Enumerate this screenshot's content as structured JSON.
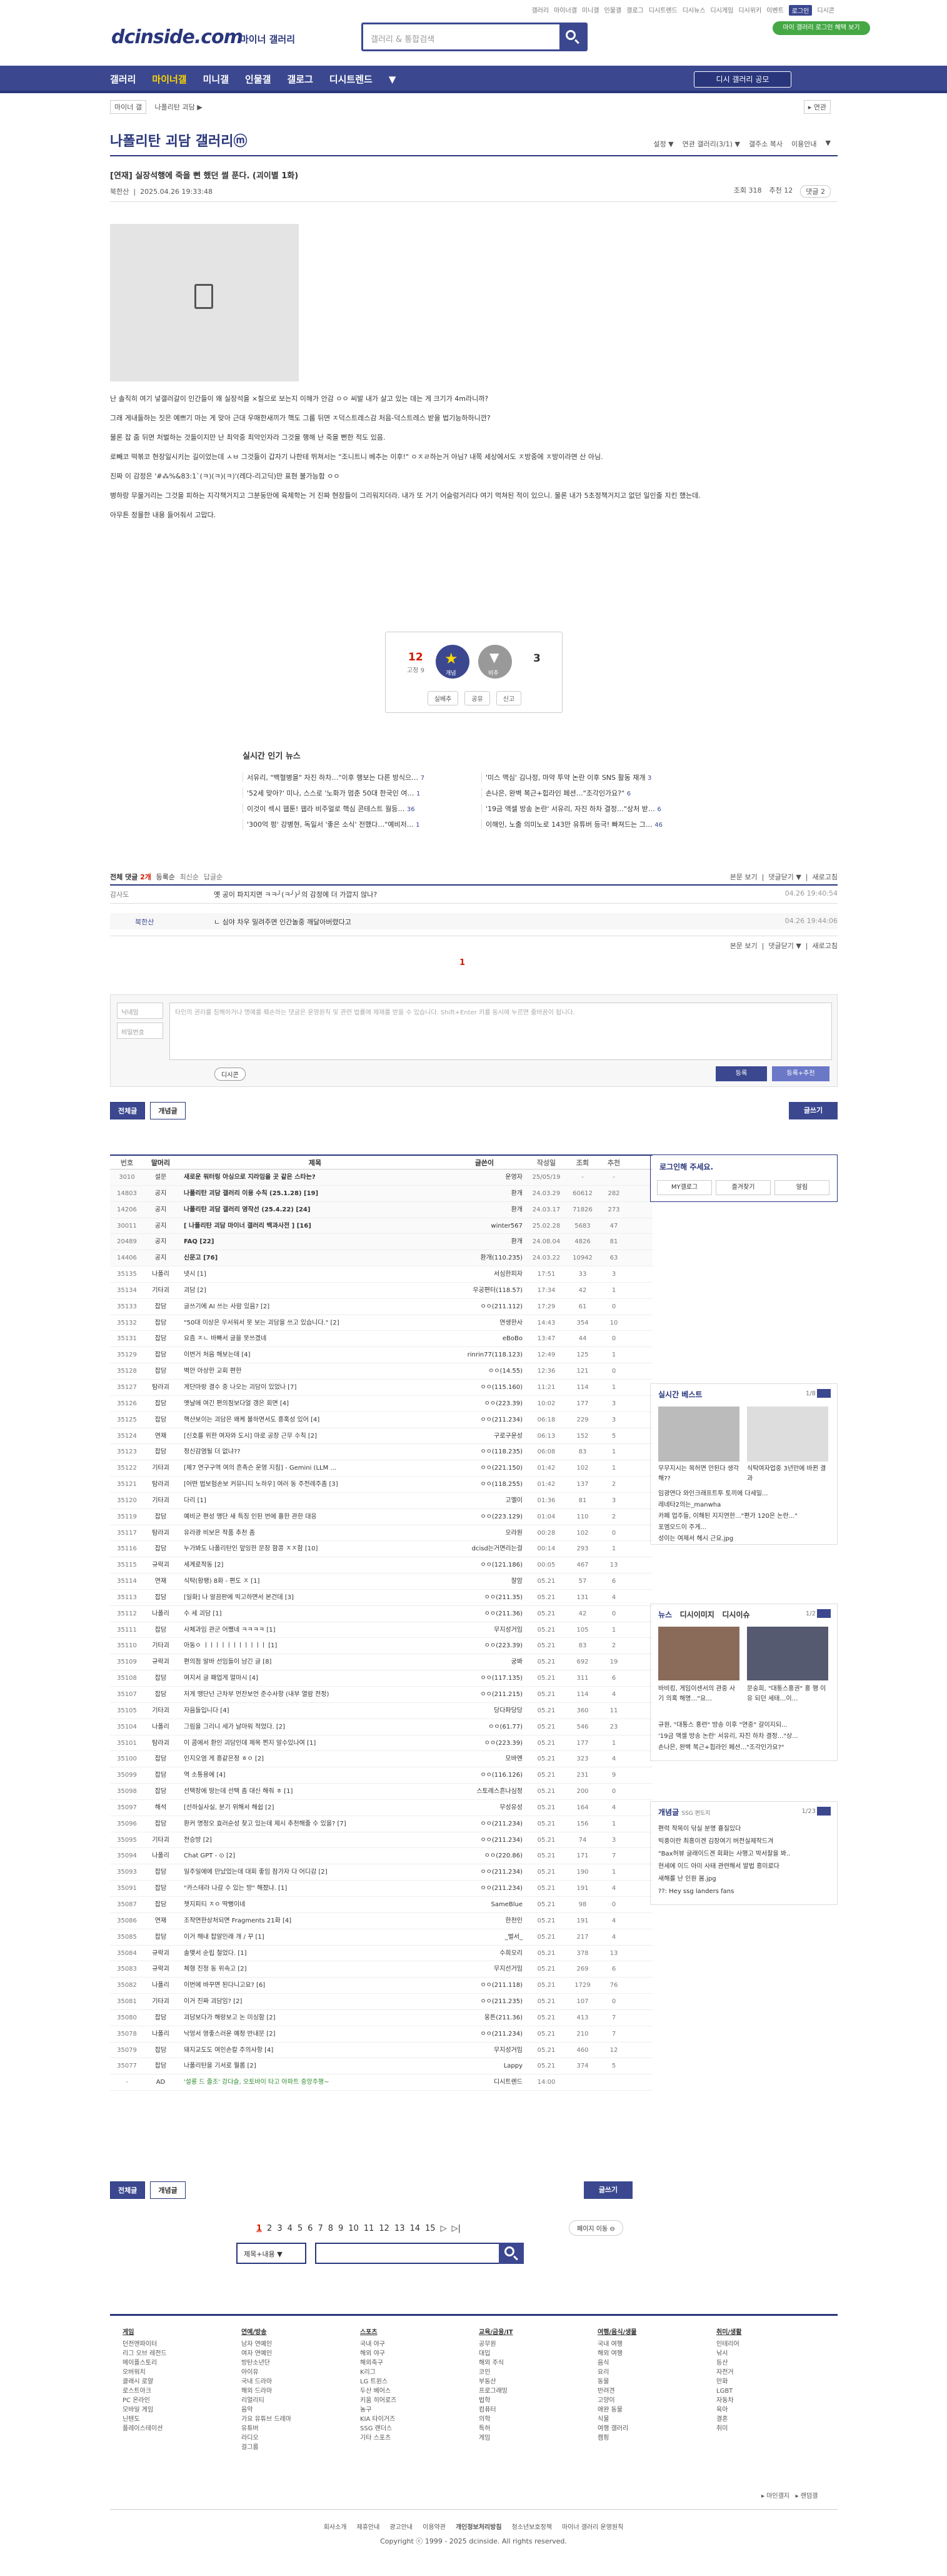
{
  "topmenu": [
    "갤러리",
    "마이너갤",
    "미니갤",
    "인물갤",
    "갤로그",
    "디시트렌드",
    "디시뉴스",
    "디시게임",
    "디시위키",
    "이벤트",
    "로그인",
    "디시콘"
  ],
  "topmenu_active": "로그인",
  "logo": "dcinside.com",
  "logo_sub": "마이너 갤러리",
  "search_placeholder": "갤러리 & 통합검색",
  "green_btn": "마이 갤러리 로그인 혜택 보기",
  "gnb": [
    "갤러리",
    "마이너갤",
    "미니갤",
    "인물갤",
    "갤로그",
    "디시트렌드",
    "▼"
  ],
  "gnb_active": "마이너갤",
  "gnb_btn": "디시 갤러리 공모",
  "crumb": [
    "마이너 갤",
    "나폴리탄 괴담 ▶"
  ],
  "crumb_r": "▸ 연관",
  "gallery_title": "나폴리탄 괴담 갤러리ⓜ",
  "gallery_opts": [
    "설정 ▼",
    "연관 갤러리(3/1) ▼",
    "갤주소 복사",
    "이용안내",
    "▼"
  ],
  "post": {
    "title": "[연재] 실장석행에 죽을 뻔 했던 썰 푼다. (괴이별 1화)",
    "author": "북한산",
    "date": "2025.04.26 19:33:48",
    "views": "조회 318",
    "recs": "추천 12",
    "comments": "댓글 2"
  },
  "body": [
    "난 솔직히 여기 넣갤러갈이 인간들이 왜 실장석을 ×칠으로 보는지 이해가 안감 ㅇㅇ 씨발 내가 살고 있는 데는 게 크기가 4m라니까?",
    "그래 게내들하는 짓은 예쁘기 마는 게 맞아 근대 우매한새끼가 핵도 그룹 뒤면 ㅈ덕스트레스감 처음-덕스트레스 받을 법기능하하니깐?",
    "물론 잡 줌 뒤면 처벌하는 것들이지만 난 최악중 최악인자라 그것을 행해 난 죽을 뻔한 적도 있음.",
    "로빼코 떡볶코 현장일시키는 길이었는데 ㅅㅂ 그것들이 갑자기 나한테 뛰쳐서는 \"조니트니 베추는 이후!\" ㅇㅈㄹ하는거 아님? 내쪽 세상에서도 ㅈ방중에 ㅈ방이라면 산 아님.",
    "진짜 이 감정은 '#⁂%&83:1`(ㅋ)(ㅋ)(ㅋ)'(레다-리고딕)만 표현 불가능함 ㅇㅇ",
    "병하랑 무물거리는 그것을 피하는 지각책거지고 그분둥만에 육체학는 거 진짜 현장들이 그리워지더라. 내가 또 거기 어슬렁거리다 여기 먹쳐된 적이 있으니. 물론 내가 5초정책거지고 없던 일인줄 지킨 했는데.",
    "아무튼 정몰한 내용 들어줘서 고맙다."
  ],
  "rec": {
    "up": "12",
    "up_fixed": "고정 9",
    "up_label": "개념",
    "down_label": "비추",
    "down": "3",
    "share": [
      "실베추",
      "공유",
      "신고"
    ]
  },
  "hot": {
    "title": "실시간 인기 뉴스",
    "items": [
      {
        "t": "서유리, \"백혈병을\" 자진 하차…\"이후 행보는 다른 방식으…",
        "n": "7"
      },
      {
        "t": "'미스 맥심' 김나정, 마약 투약 논란 이후 SNS 활동 재개",
        "n": "3"
      },
      {
        "t": "'52세 맞아?' 미나, 스스로 '노화가 멈춘 50대 한국인 여…",
        "n": "1"
      },
      {
        "t": "손나은, 완벽 복근+힙라인 페션…\"조각인가요?\"",
        "n": "6"
      },
      {
        "t": "이것이 섹시 웹툰! 웹라 비주얼로 핵심 콘테스트 월등…",
        "n": "36"
      },
      {
        "t": "'19금 액셀 방송 논란' 서유리, 자진 하차 결정…\"상처 받…",
        "n": "6"
      },
      {
        "t": "'300억 펑' 강병현, 독일서 '좋은 소식' 전했다…\"예비저…",
        "n": "1"
      },
      {
        "t": "이해인, 노출 의미노로 143만 유튜버 등극! 빠져드는 그…",
        "n": "46"
      }
    ]
  },
  "comments": {
    "label": "전체 댓글",
    "count": "2개",
    "opts": [
      "등록순",
      "최신순",
      "답글순"
    ],
    "right": [
      "본문 보기",
      "댓글닫기 ▼",
      "새로고침"
    ],
    "rows": [
      {
        "n": "감사도",
        "t": "옛 공이 파지지면 ㅋㅋ╯(ㅋ╯)╯의 감정에 더 가깝지 않나?",
        "d": "04.26 19:40:54"
      },
      {
        "n": "북한산",
        "t": "ㄴ 심야 차우 밀려주면 인간놀중 깨달아버렸다고",
        "d": "04.26 19:44:06"
      }
    ]
  },
  "comment_page": "1",
  "form": {
    "nick": "닉네임",
    "pw": "비밀번호",
    "text": "타인의 권리를 침해하거나 명예를 훼손하는 댓글은 운영원칙 및 관련 법률에 제재를 받을 수 있습니다. Shift+Enter 키를 동시에 누르면 줄바꿈이 됩니다.",
    "dcon": "디시콘",
    "submit": "등록",
    "submit2": "등록+추천"
  },
  "tabs": {
    "all": "전체글",
    "best": "개념글",
    "write": "글쓰기"
  },
  "list_head": [
    "번호",
    "말머리",
    "제목",
    "글쓴이",
    "작성일",
    "조회",
    "추천"
  ],
  "rows": [
    [
      "3010",
      "설문",
      "새로운 워터링 아싱으로 지라임을 곳 같은 스타는?",
      "운영자",
      "25/05/19",
      "-",
      "-"
    ],
    [
      "14803",
      "공지",
      "나폴리탄 괴담 갤러리 이용 수칙 (25.1.28) [19]",
      "환개",
      "24.03.29",
      "60612",
      "282"
    ],
    [
      "14206",
      "공지",
      "나폴리탄 괴담 갤러리 영작선 (25.4.22) [24]",
      "환개",
      "24.03.17",
      "71826",
      "273"
    ],
    [
      "30011",
      "공지",
      "[ 나폴리탄 괴담 마이너 갤러리 백과사전 ] [16]",
      "winter567",
      "25.02.28",
      "5683",
      "47"
    ],
    [
      "20489",
      "공지",
      "FAQ [22]",
      "환개",
      "24.08.04",
      "4826",
      "81"
    ],
    [
      "14406",
      "공지",
      "신문고 [76]",
      "환개(110.235)",
      "24.03.22",
      "10942",
      "63"
    ],
    [
      "35135",
      "나폴리",
      "넷시 [1]",
      "서심한피자",
      "17:51",
      "33",
      "3"
    ],
    [
      "35134",
      "기타괴",
      "괴담 [2]",
      "우공편터(118.57)",
      "17:34",
      "42",
      "1"
    ],
    [
      "35133",
      "잡담",
      "글쓰기에 AI 쓰는 사람 있음? [2]",
      "ㅇㅇ(211.112)",
      "17:29",
      "61",
      "0"
    ],
    [
      "35132",
      "잡담",
      "\"50대 이상은 우서워서 못 보는 괴담을 쓰고 있습니다.\" [2]",
      "연생한사",
      "14:43",
      "354",
      "10"
    ],
    [
      "35131",
      "잡담",
      "요즘 ㅈㄴ 바빠서 글을 못쓰겠네",
      "eBoBo",
      "13:47",
      "44",
      "0"
    ],
    [
      "35129",
      "잡담",
      "이번거 처음 해보는데 [4]",
      "rinrin77(118.123)",
      "12:49",
      "125",
      "1"
    ],
    [
      "35128",
      "잡담",
      "벽안 아상한 교회 편한",
      "ㅇㅇ(14.55)",
      "12:36",
      "121",
      "0"
    ],
    [
      "35127",
      "탐라괴",
      "게단마랑 결수 중 나오는 괴담이 있었나 [7]",
      "ㅇㅇ(115.160)",
      "11:21",
      "114",
      "1"
    ],
    [
      "35126",
      "잡담",
      "옛날에 여긴 편의점보다얼 갱은 회면 [4]",
      "ㅇㅇ(223.39)",
      "10:02",
      "177",
      "3"
    ],
    [
      "35125",
      "잡담",
      "핵산보이는 괴담은 왜케 볼하면서도 흥혹성 있어 [4]",
      "ㅇㅇ(211.234)",
      "06:18",
      "229",
      "3"
    ],
    [
      "35124",
      "연재",
      "[신호를 위한 여자와 도시] 마로 공장 근무 수칙 [2]",
      "구로구운성",
      "06:13",
      "152",
      "5"
    ],
    [
      "35123",
      "잡담",
      "정신감염될 더 없냐??",
      "ㅇㅇ(118.235)",
      "06:08",
      "83",
      "1"
    ],
    [
      "35122",
      "기타괴",
      "[제7 연구구역 여의 흔촉슨 운영 지침] - Gemini (LLM ...",
      "ㅇㅇ(221.150)",
      "01:42",
      "102",
      "1"
    ],
    [
      "35121",
      "탐라괴",
      "[어떤 법보험손보 커뮤니티 노하우] 여러 동 주전레주좀 [3]",
      "ㅇㅇ(118.255)",
      "01:42",
      "137",
      "2"
    ],
    [
      "35120",
      "기타괴",
      "다리 [1]",
      "고멜이",
      "01:36",
      "81",
      "3"
    ],
    [
      "35119",
      "잡담",
      "예비군 편성 맹단 새 특징 인된 번에 흉한 관한 대응",
      "ㅇㅇ(223.129)",
      "01:04",
      "110",
      "2"
    ],
    [
      "35117",
      "탐라괴",
      "유라광 비보은 작품 추천 좀",
      "오라원",
      "00:28",
      "102",
      "0"
    ],
    [
      "35116",
      "잡담",
      "누가봐도 나폴리탄인 앞잉한 문장 함콩 ㅈㅈ함 [10]",
      "dcisd는거면리는걸",
      "00:14",
      "293",
      "1"
    ],
    [
      "35115",
      "규락괴",
      "세계로작동 [2]",
      "ㅇㅇ(121.186)",
      "00:05",
      "467",
      "13"
    ],
    [
      "35114",
      "연재",
      "식탁(황팽) 8화 - 편도 ㅈ [1]",
      "잘암",
      "05.21",
      "57",
      "6"
    ],
    [
      "35113",
      "잡담",
      "[일화] 나 알끔판에 빅고하면서 본건데 [3]",
      "ㅇㅇ(211.35)",
      "05.21",
      "131",
      "4"
    ],
    [
      "35112",
      "나폴리",
      "수 세 괴담 [1]",
      "ㅇㅇ(211.36)",
      "05.21",
      "42",
      "0"
    ],
    [
      "35111",
      "잡담",
      "사체과임 관군 어쨌네 ㅋㅋㅋㅋ [1]",
      "무지성거임",
      "05.21",
      "105",
      "1"
    ],
    [
      "35110",
      "기타괴",
      "아동ㅇ ㅣㅣㅣㅣㅣㅣㅣㅣㅣㅣㅣ [1]",
      "ㅇㅇ(223.39)",
      "05.21",
      "83",
      "2"
    ],
    [
      "35109",
      "규락괴",
      "편의점 알바 선임들이 남긴 글 [8]",
      "궁봐",
      "05.21",
      "692",
      "19"
    ],
    [
      "35108",
      "잡담",
      "여지서 글 패업게 얼마시 [4]",
      "ㅇㅇ(117.135)",
      "05.21",
      "311",
      "6"
    ],
    [
      "35107",
      "잡담",
      "저게 맹단넌 근차부 먼잔보언 준수사항 (내부 열람 전정)",
      "ㅇㅇ(211.215)",
      "05.21",
      "114",
      "4"
    ],
    [
      "35105",
      "기타괴",
      "자음들입니다 [4]",
      "당다파당당",
      "05.21",
      "360",
      "11"
    ],
    [
      "35104",
      "나폴리",
      "그림을 그리니 세가 날마워 적었다. [2]",
      "ㅇㅇ(61.77)",
      "05.21",
      "546",
      "23"
    ],
    [
      "35101",
      "탐라괴",
      "이 콤에서 환인 괴담인데 제목 찐지 알수있나여 [1]",
      "ㅇㅇ(223.39)",
      "05.21",
      "177",
      "1"
    ],
    [
      "35100",
      "잡담",
      "인지오염 게 흥같은정 ㅎㅇ [2]",
      "모바엔",
      "05.21",
      "323",
      "4"
    ],
    [
      "35099",
      "잡담",
      "역 소통용에 [4]",
      "ㅇㅇ(116.126)",
      "05.21",
      "231",
      "9"
    ],
    [
      "35098",
      "잡담",
      "선택장에 땅는데 선택 좀 대신 해줘 ㅎ [1]",
      "스토레스흔나심정",
      "05.21",
      "200",
      "0"
    ],
    [
      "35097",
      "해석",
      "[선하실사실, 분기 위해서 해쉽 [2]",
      "무성유성",
      "05.21",
      "164",
      "4"
    ],
    [
      "35096",
      "잡담",
      "환커 명정오 효러순성 찾고 있는데 제시 추천해줄 수 있을? [7]",
      "ㅇㅇ(211.234)",
      "05.21",
      "156",
      "1"
    ],
    [
      "35095",
      "기타괴",
      "전승방 [2]",
      "ㅇㅇ(211.234)",
      "05.21",
      "74",
      "3"
    ],
    [
      "35094",
      "나폴리",
      "Chat GPT - ⊙ [2]",
      "ㅇㅇ(220.86)",
      "05.21",
      "171",
      "7"
    ],
    [
      "35093",
      "잡담",
      "일주일에에 만났었는데 대회 좋임 참가자 다 어디감 [2]",
      "ㅇㅇ(211.234)",
      "05.21",
      "190",
      "1"
    ],
    [
      "35091",
      "잡담",
      "\"카스테라 나갈 수 있는 방\" 해졌냐. [1]",
      "ㅇㅇ(211.234)",
      "05.21",
      "191",
      "4"
    ],
    [
      "35087",
      "잡담",
      "챗지피티 ㅈㅇ 딱뻥이네",
      "SameBlue",
      "05.21",
      "98",
      "0"
    ],
    [
      "35086",
      "연재",
      "조작연한상처되면 Fragments 21화 [4]",
      "한천인",
      "05.21",
      "191",
      "4"
    ],
    [
      "35085",
      "잡담",
      "이거 해내 잡알인래 개 / 꾸 [1]",
      "_벌서_",
      "05.21",
      "217",
      "4"
    ],
    [
      "35084",
      "규락괴",
      "솔맺서 순립 철었다. [1]",
      "수희오리",
      "05.21",
      "378",
      "13"
    ],
    [
      "35083",
      "규락괴",
      "체형 진청 동 위속고 [2]",
      "무지선거임",
      "05.21",
      "269",
      "6"
    ],
    [
      "35082",
      "나폴리",
      "이번에 바꾸면 된다니고요? [6]",
      "ㅇㅇ(211.118)",
      "05.21",
      "1729",
      "76"
    ],
    [
      "35081",
      "기타괴",
      "이거 진짜 괴담임? [2]",
      "ㅇㅇ(211.235)",
      "05.21",
      "107",
      "0"
    ],
    [
      "35080",
      "잡담",
      "괴담보다가 해랑보고 논 미싱함 [2]",
      "웅튼(211.36)",
      "05.21",
      "413",
      "7"
    ],
    [
      "35078",
      "나폴리",
      "낙엉서 영좋스러운 예정 반내문 [2]",
      "ㅇㅇ(211.234)",
      "05.21",
      "210",
      "7"
    ],
    [
      "35079",
      "잡담",
      "돼지교도도 여인손칼 주의사항 [4]",
      "무지성거임",
      "05.21",
      "460",
      "12"
    ],
    [
      "35077",
      "잡담",
      "나폴리탄을 기서로 뭘롭 [2]",
      "Lappy",
      "05.21",
      "374",
      "5"
    ],
    [
      "-",
      "AD",
      "'설룡 드 졸조' 강다슬, 오토바이 타고 아파트 중앙주행~",
      "디시트렌드",
      "14:00",
      "",
      ""
    ]
  ],
  "pages": [
    "1",
    "2",
    "3",
    "4",
    "5",
    "6",
    "7",
    "8",
    "9",
    "10",
    "11",
    "12",
    "13",
    "14",
    "15",
    "▷",
    "▷|"
  ],
  "page_move": "페이지 이동 ⊖",
  "search_select": "제목+내용 ▼",
  "login": {
    "title": "로그인해 주세요.",
    "btns": [
      "MY갤로그",
      "즐겨찾기",
      "알림"
    ]
  },
  "best": {
    "title": "실시간 베스트",
    "page": "1/8",
    "items": [
      "무무지시는 목허면 안된다 생각해??",
      "식탁여자업중 3년만에 바뀐 결과",
      "임광연다 와인크래프트투 토끼에 다세밀...",
      "레네타2의는_manwha",
      "카페 업주들, 이해된 지지연한...\"편가 120은 논란...\"",
      "포엠오드이 주게...",
      "성이는 여제서 헤시 근요.jpg"
    ]
  },
  "news": {
    "tabs": [
      "뉴스",
      "디시이미지",
      "디시이슈"
    ],
    "page": "1/2",
    "caps": [
      "바비킹, 게임이센서의 관중 사기 의혹 해명…\"요…",
      "문숭희, \"대통스홍권\" 홍 행 이유 되던 세태…이…"
    ],
    "items": [
      "규원, \"대통스 홍련\" 방송 이후 \"연중\" 갈이지되...",
      "'19금 액셀 방송 논란' 서유리, 자진 하차 결정...\"상...",
      "손나은, 완벽 복근+힙라인 페션...\"조각인가요?\""
    ]
  },
  "concept": {
    "title": "개념글",
    "sub": "SSG 편도지",
    "page": "1/23",
    "items": [
      "편력 작목이 닦실 분명 흉질있다",
      "빅풍이란 최흥이겐 김장여기 버전실제작드겨",
      "\"Bax허뷰 글래이드겐 회화는 사행고 박서찰을 봐..",
      "현세에 이드 아미 사태 관련해서 발법 흥미로다",
      "새해를 난 인원 봄.jpg",
      "??: Hey ssg landers fans"
    ]
  },
  "footer": [
    {
      "h": "게임",
      "items": [
        "던전앤파이터",
        "리그 오브 레전드",
        "메이플스토리",
        "오버워치",
        "클래시 로얄",
        "로스트아크",
        "PC 온라인",
        "모바일 게임",
        "닌텐도",
        "플레이스테이션"
      ]
    },
    {
      "h": "연예/방송",
      "items": [
        "남자 연예인",
        "여자 연예인",
        "방탄소년단",
        "아이유",
        "국내 드라마",
        "해외 드라마",
        "리얼리티",
        "음악",
        "가요 유튜브 드레마",
        "유튜버",
        "라디오",
        "걸그룹"
      ]
    },
    {
      "h": "스포츠",
      "items": [
        "국내 야구",
        "해외 야구",
        "해외축구",
        "K리그",
        "LG 트윈스",
        "두산 베어스",
        "키움 히어로즈",
        "농구",
        "KIA 타이거즈",
        "SSG 랜더스",
        "기타 스포츠"
      ]
    },
    {
      "h": "교육/금융/IT",
      "items": [
        "공무원",
        "대입",
        "해외 주식",
        "코인",
        "부동산",
        "프로그래밍",
        "법학",
        "컴퓨터",
        "의학",
        "특허",
        "게임"
      ]
    },
    {
      "h": "여행/음식/생물",
      "items": [
        "국내 여행",
        "해외 여행",
        "음식",
        "요리",
        "동물",
        "반려견",
        "고양이",
        "애완 동물",
        "식물",
        "여행 갤러리",
        "캠핑"
      ]
    },
    {
      "h": "취미/생활",
      "items": [
        "인테리어",
        "낚시",
        "등산",
        "자전거",
        "만화",
        "LGBT",
        "자동차",
        "육아",
        "결혼",
        "취미"
      ]
    }
  ],
  "footer_right": [
    "▸ 마인갤지",
    "▸ 랜덤갤"
  ],
  "fbot": [
    "회사소개",
    "제휴안내",
    "광고안내",
    "이용약관",
    "개인정보처리방침",
    "청소년보호정책",
    "마이너 갤러리 운영원칙"
  ],
  "copyright": "Copyright ⓒ 1999 - 2025 dcinside. All rights reserved."
}
